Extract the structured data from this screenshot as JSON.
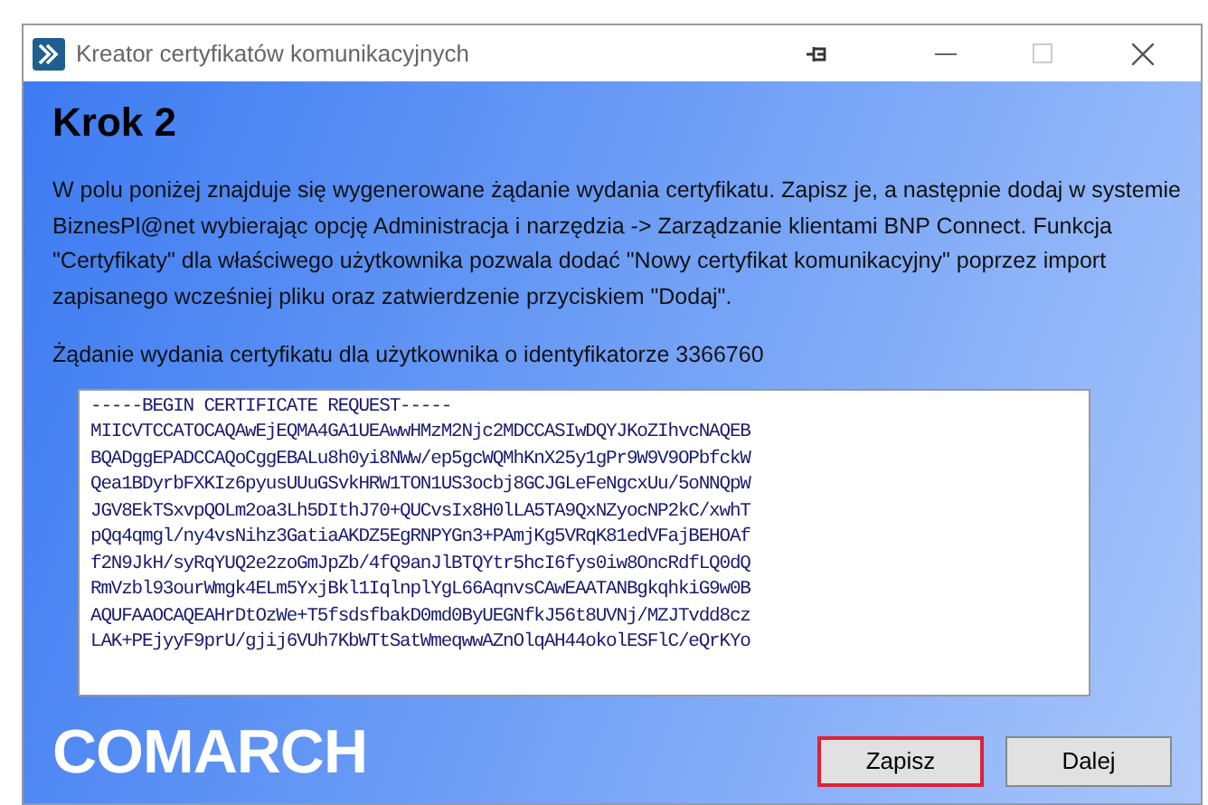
{
  "window": {
    "title": "Kreator certyfikatów komunikacyjnych"
  },
  "heading": "Krok 2",
  "description": "W polu poniżej znajduje się wygenerowane żądanie wydania certyfikatu. Zapisz je, a następnie dodaj w systemie BiznesPl@net wybierając opcję Administracja i narzędzia -> Zarządzanie klientami BNP Connect. Funkcja \"Certyfikaty\" dla właściwego użytkownika pozwala dodać \"Nowy certyfikat komunikacyjny\" poprzez import zapisanego wcześniej pliku oraz zatwierdzenie przyciskiem \"Dodaj\".",
  "request_label": "Żądanie wydania certyfikatu dla użytkownika o identyfikatorze 3366760",
  "request_lines": [
    "-----BEGIN CERTIFICATE REQUEST-----",
    "MIICVTCCATOCAQAwEjEQMA4GA1UEAwwHMzM2Njc2MDCCASIwDQYJKoZIhvcNAQEB",
    "BQADggEPADCCAQoCggEBALu8h0yi8NWw/ep5gcWQMhKnX25y1gPr9W9V9OPbfckW",
    "Qea1BDyrbFXKIz6pyusUUuGSvkHRW1TON1US3ocbj8GCJGLeFeNgcxUu/5oNNQpW",
    "JGV8EkTSxvpQOLm2oa3Lh5DIthJ70+QUCvsIx8H0lLA5TA9QxNZyocNP2kC/xwhT",
    "pQq4qmgl/ny4vsNihz3GatiaAKDZ5EgRNPYGn3+PAmjKg5VRqK81edVFajBEHOAf",
    "f2N9JkH/syRqYUQ2e2zoGmJpZb/4fQ9anJlBTQYtr5hcI6fys0iw8OncRdfLQ0dQ",
    "RmVzbl93ourWmgk4ELm5YxjBkl1IqlnplYgL66AqnvsCAwEAATANBgkqhkiG9w0B",
    "AQUFAAOCAQEAHrDtOzWe+T5fsdsfbakD0md0ByUEGNfkJ56t8UVNj/MZJTvdd8cz",
    "LAK+PEjyyF9prU/gjij6VUh7KbWTtSatWmeqwwAZnOlqAH44okolESFlC/eQrKYo"
  ],
  "logo": "COMARCH",
  "buttons": [
    {
      "label": "Zapisz",
      "selected": true
    },
    {
      "label": "Dalej",
      "selected": false
    }
  ]
}
